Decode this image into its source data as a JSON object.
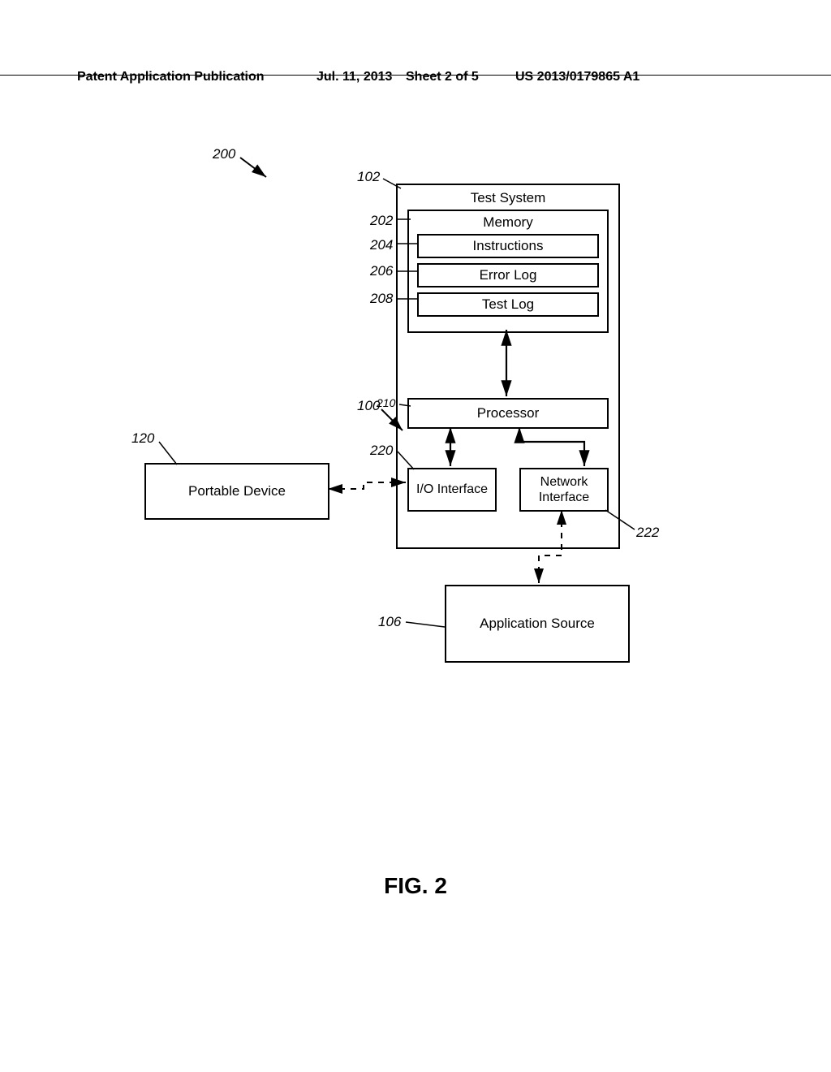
{
  "header": {
    "publication_ref": "Patent Application Publication",
    "date": "Jul. 11, 2013",
    "sheet": "Sheet 2 of 5",
    "pubid": "US 2013/0179865 A1"
  },
  "figure_label": "FIG. 2",
  "refs": {
    "r200": "200",
    "r102": "102",
    "r202": "202",
    "r204": "204",
    "r206": "206",
    "r208": "208",
    "r210": "210",
    "r100": "100",
    "r120": "120",
    "r220": "220",
    "r222": "222",
    "r106": "106"
  },
  "boxes": {
    "test_system": "Test System",
    "memory": "Memory",
    "instructions": "Instructions",
    "error_log": "Error Log",
    "test_log": "Test Log",
    "processor": "Processor",
    "io_interface": "I/O Interface",
    "network_interface": "Network Interface",
    "portable_device": "Portable Device",
    "app_source": "Application Source"
  }
}
